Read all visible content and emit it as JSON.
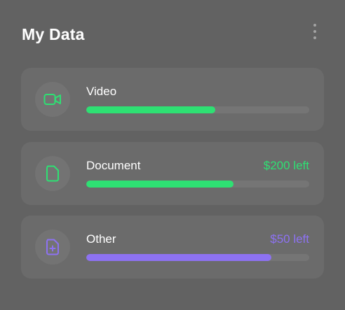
{
  "header": {
    "title": "My Data"
  },
  "colors": {
    "green": "#2ee073",
    "purple": "#8d72f2"
  },
  "rows": [
    {
      "label": "Video",
      "left_text": "",
      "progress": 0.58,
      "color": "#2ee073",
      "icon": "video-camera-icon"
    },
    {
      "label": "Document",
      "left_text": "$200 left",
      "progress": 0.66,
      "color": "#2ee073",
      "icon": "document-icon"
    },
    {
      "label": "Other",
      "left_text": "$50 left",
      "progress": 0.83,
      "color": "#8d72f2",
      "icon": "file-plus-icon"
    }
  ]
}
